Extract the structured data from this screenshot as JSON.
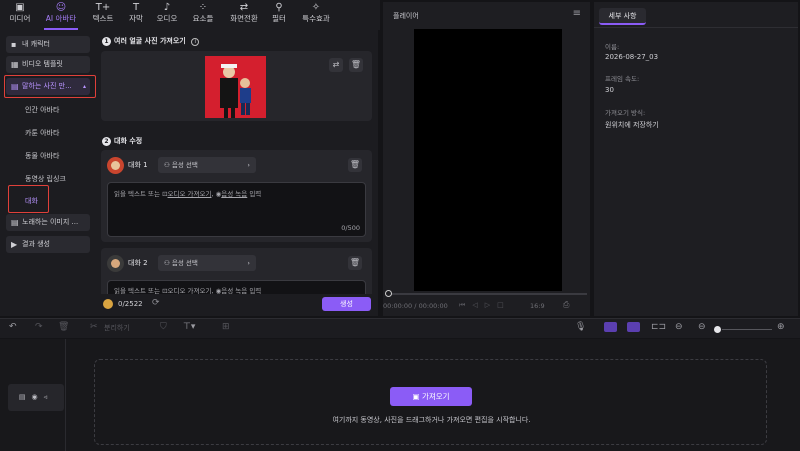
{
  "toolbar": {
    "tabs": [
      {
        "label": "미디어",
        "icon": "media-icon",
        "glyph": "▣"
      },
      {
        "label": "AI 아바타",
        "icon": "avatar-icon",
        "glyph": "☺"
      },
      {
        "label": "텍스트",
        "icon": "text-icon",
        "glyph": "T+"
      },
      {
        "label": "자막",
        "icon": "subtitle-icon",
        "glyph": "T"
      },
      {
        "label": "오디오",
        "icon": "music-icon",
        "glyph": "♪"
      },
      {
        "label": "요소들",
        "icon": "elements-icon",
        "glyph": "⁘"
      },
      {
        "label": "화면전환",
        "icon": "transition-icon",
        "glyph": "⇄"
      },
      {
        "label": "필터",
        "icon": "filter-icon",
        "glyph": "⚲"
      },
      {
        "label": "특수효과",
        "icon": "effects-icon",
        "glyph": "✧"
      }
    ],
    "active_tab": "AI 아바타"
  },
  "sidebar": {
    "items": [
      {
        "label": "내 캐릭터"
      },
      {
        "label": "비디오 템플릿"
      },
      {
        "label": "말하는 사진 만..."
      }
    ],
    "subitems": [
      "인간 아바타",
      "카툰 아바타",
      "동물 아바타",
      "동영상 립싱크",
      "대화"
    ],
    "items_bottom": [
      {
        "label": "노래하는 이미지 ..."
      },
      {
        "label": "결과 생성"
      }
    ]
  },
  "content": {
    "step1": {
      "num": "1",
      "title": "여러 얼굴 사진 가져오기"
    },
    "step2": {
      "num": "2",
      "title": "대화 수정"
    },
    "dialogs": [
      {
        "name": "대화 1",
        "voice": "음성 선택",
        "counter": "0/500",
        "placeholder_pre": "읽을 텍스트 또는 ",
        "import_audio": "오디오 가져오기",
        "sep": ", ",
        "record": "음성 녹음",
        "placeholder_post": " 입력"
      },
      {
        "name": "대화 2",
        "voice": "음성 선택",
        "placeholder_pre": "읽을 텍스트 또는 ",
        "import_audio": "오디오 가져오기",
        "sep": ", ",
        "record": "음성 녹음",
        "placeholder_post": " 입력"
      }
    ],
    "credits": "0/2522",
    "generate_label": "생성"
  },
  "player": {
    "title": "플레이어",
    "time_current": "00:00:00",
    "time_sep": "/",
    "time_total": "00:00:00",
    "aspect": "16:9"
  },
  "details": {
    "tab": "세부 사항",
    "name_label": "이름:",
    "name_value": "2026-08-27_03",
    "fps_label": "프레임 속도:",
    "fps_value": "30",
    "import_label": "가져오기 방식:",
    "import_value": "원위치에 저장하기"
  },
  "timeline": {
    "split_label": "분리하기",
    "import_button": "가져오기",
    "hint": "여기까지 동영상, 사진을 드래그하거나 가져오면 편집을 시작합니다."
  },
  "colors": {
    "accent": "#8b5cf6",
    "highlight": "#e0403a",
    "photo_bg": "#d41f2e"
  }
}
